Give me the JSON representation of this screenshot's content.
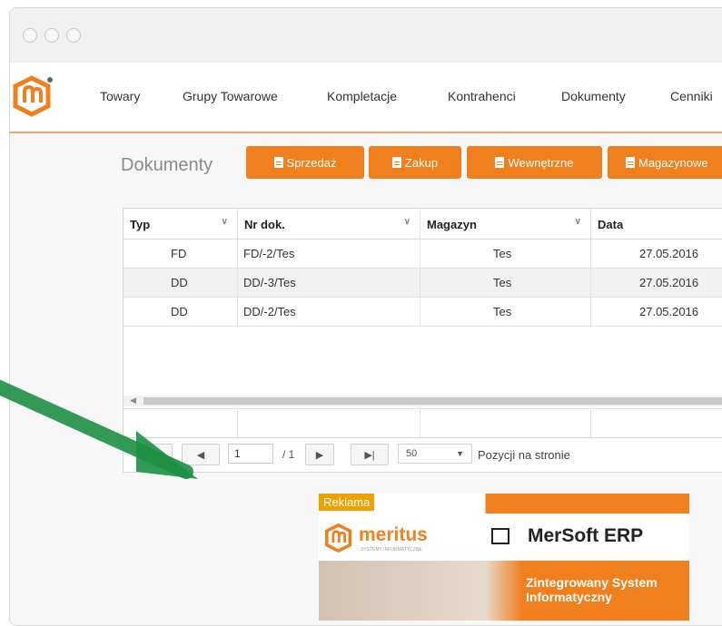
{
  "nav": {
    "items": [
      "Towary",
      "Grupy Towarowe",
      "Kompletacje",
      "Kontrahenci",
      "Dokumenty",
      "Cenniki"
    ]
  },
  "page": {
    "title": "Dokumenty",
    "buttons": [
      "Sprzedaż",
      "Zakup",
      "Wewnętrzne",
      "Magazynowe"
    ]
  },
  "grid": {
    "columns": [
      "Typ",
      "Nr dok.",
      "Magazyn",
      "Data"
    ],
    "rows": [
      {
        "typ": "FD",
        "nr": "FD/-2/Tes",
        "magazyn": "Tes",
        "data": "27.05.2016"
      },
      {
        "typ": "DD",
        "nr": "DD/-3/Tes",
        "magazyn": "Tes",
        "data": "27.05.2016"
      },
      {
        "typ": "DD",
        "nr": "DD/-2/Tes",
        "magazyn": "Tes",
        "data": "27.05.2016"
      }
    ]
  },
  "pager": {
    "page": "1",
    "of": "/ 1",
    "page_size": "50",
    "per_page_label": "Pozycji na stronie"
  },
  "ad": {
    "badge": "Reklama",
    "brand": "meritus",
    "brand_sub": "SYSTEMY INFORMATYCZNE",
    "product": "MerSoft ERP",
    "tagline1": "Zintegrowany System",
    "tagline2": "Informatyczny"
  },
  "colors": {
    "accent": "#f07f1d",
    "arrow": "#1e8f45"
  }
}
